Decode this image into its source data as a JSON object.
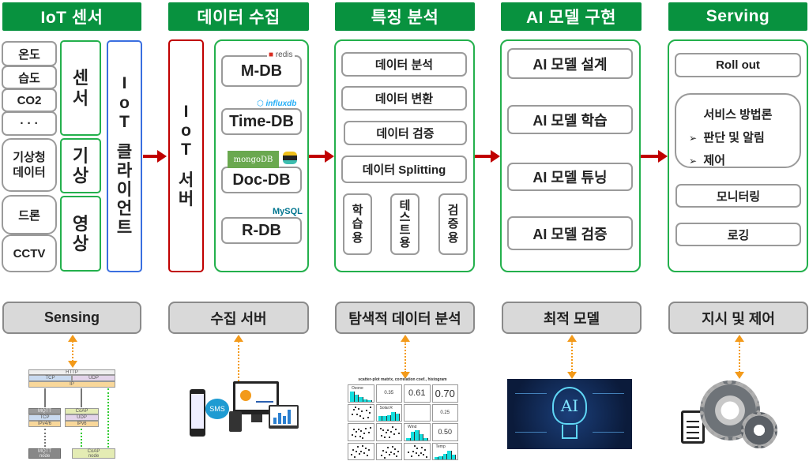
{
  "headers": [
    "IoT 센서",
    "데이터 수집",
    "특징 분석",
    "AI 모델 구현",
    "Serving"
  ],
  "sensor": {
    "items": [
      "온도",
      "습도",
      "CO2",
      "· · ·",
      "기상청\n데이터",
      "드론",
      "CCTV"
    ],
    "groups": [
      "센\n서",
      "기\n상",
      "영\n상"
    ],
    "client": [
      "I",
      "o",
      "T",
      "",
      "클",
      "라",
      "이",
      "언",
      "트"
    ]
  },
  "collect": {
    "server": [
      "I",
      "o",
      "T",
      "",
      "서",
      "버"
    ],
    "dbs": [
      {
        "label": "M-DB",
        "logo": "redis",
        "logo_color": "#d82c20"
      },
      {
        "label": "Time-DB",
        "logo": "influxdb",
        "logo_color": "#22adf6"
      },
      {
        "label": "Doc-DB",
        "logo": "mongoDB",
        "logo_color": "#ffffff"
      },
      {
        "label": "R-DB",
        "logo": "MySQL",
        "logo_color": "#00758f"
      }
    ]
  },
  "feature": {
    "items": [
      "데이터 분석",
      "데이터 변환",
      "데이터 검증",
      "데이터 Splitting"
    ],
    "splits": [
      "학\n습\n용",
      "테\n스\n트\n용",
      "검\n증\n용"
    ]
  },
  "model": {
    "items": [
      "AI 모델 설계",
      "AI 모델 학습",
      "AI 모델 튜닝",
      "AI 모델 검증"
    ]
  },
  "serving": {
    "rollout": "Roll out",
    "method_title": "서비스 방법론",
    "method_items": [
      "판단 및 알림",
      "제어"
    ],
    "bullet": "➢",
    "monitoring": "모니터링",
    "logging": "로깅"
  },
  "bottom_labels": [
    "Sensing",
    "수집 서버",
    "탐색적 데이터 분석",
    "최적 모델",
    "지시 및 제어"
  ],
  "illustrations": {
    "protocol": {
      "http": "HTTP",
      "tcp": "TCP",
      "udp": "UDP",
      "ip": "IP",
      "mqtt": "MQTT",
      "coap": "CoAP",
      "ipv46": "IPv4/6",
      "ipv6": "IPv6",
      "mqtt_node": "MQTT\nnode",
      "coap_node": "CoAP\nnode"
    },
    "sms": "SMS",
    "scatter_title": "scatter-plot matrix, correlation coef., histogram",
    "scatter_vars": [
      "Ozone",
      "Solar.R",
      "Wind",
      "Temp"
    ],
    "scatter_coefs": [
      "0.35",
      "0.61",
      "0.70",
      "0.25",
      "0.50"
    ],
    "ai_text": "AI"
  },
  "colors": {
    "header_green": "#08923f",
    "box_green": "#23b04c",
    "client_blue": "#3a6fe0",
    "server_red": "#c00000",
    "arrow_red": "#c00000",
    "dotted_orange": "#f39a1a"
  }
}
